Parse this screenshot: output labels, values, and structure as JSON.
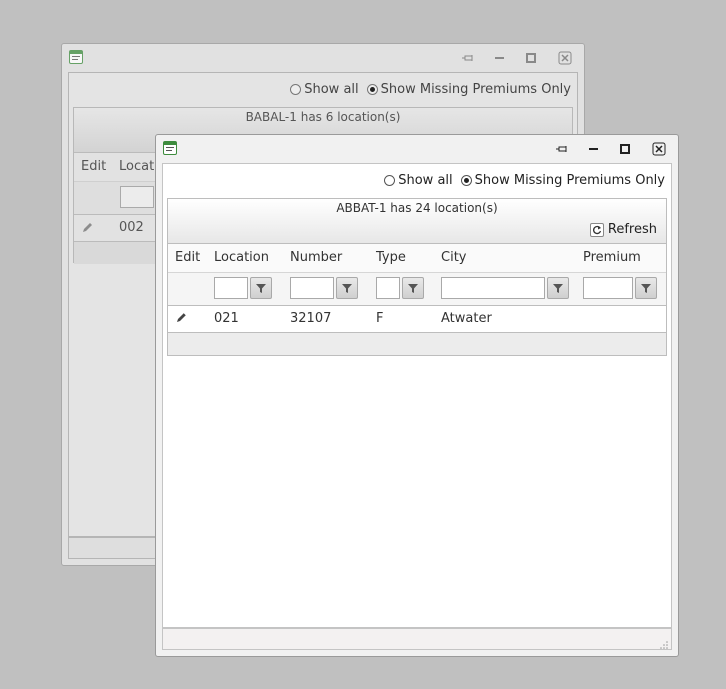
{
  "back_window": {
    "radio_show_all": "Show all",
    "radio_missing": "Show Missing Premiums Only",
    "caption": "BABAL-1 has 6 location(s)",
    "columns": {
      "edit": "Edit",
      "location": "Locati"
    },
    "row": {
      "location": "002"
    }
  },
  "front_window": {
    "radio_show_all": "Show all",
    "radio_missing": "Show Missing Premiums Only",
    "selected_filter": "Show Missing Premiums Only",
    "caption": "ABBAT-1 has 24 location(s)",
    "refresh_label": "Refresh",
    "columns": {
      "edit": "Edit",
      "location": "Location",
      "number": "Number",
      "type": "Type",
      "city": "City",
      "premium": "Premium"
    },
    "rows": [
      {
        "location": "021",
        "number": "32107",
        "type": "F",
        "city": "Atwater",
        "premium": ""
      }
    ]
  },
  "icons": {
    "app": "form-icon",
    "pin": "pin-icon",
    "minimize": "minimize-icon",
    "maximize": "maximize-icon",
    "close": "close-icon",
    "filter": "filter-icon",
    "edit": "pencil-icon",
    "refresh": "refresh-icon"
  },
  "colors": {
    "desktop": "#c0c0c0",
    "window_frame": "#f1f1f1",
    "app_icon_accent": "#3e8c3e"
  }
}
